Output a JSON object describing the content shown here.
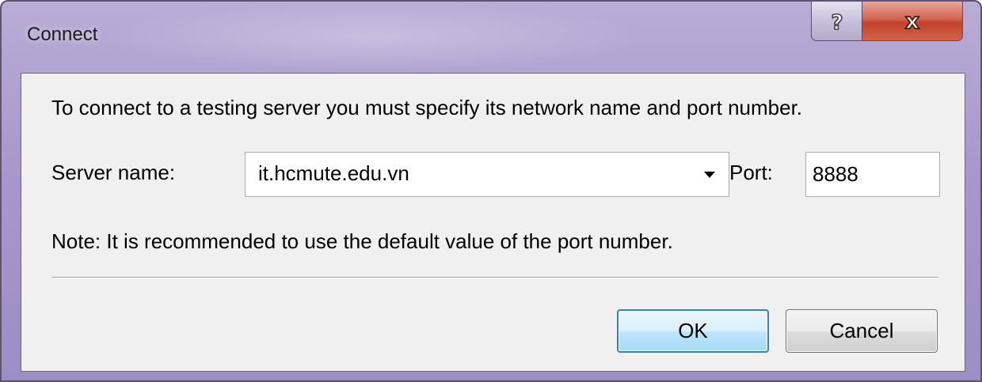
{
  "window": {
    "title": "Connect",
    "help_button_label": "?",
    "close_button_label": "x"
  },
  "dialog": {
    "instruction": "To connect to a testing server you must specify its network name and port number.",
    "server_name_label": "Server name:",
    "server_name_value": "it.hcmute.edu.vn",
    "port_label": "Port:",
    "port_value": "8888",
    "note": "Note: It is recommended to use the default value of the port number."
  },
  "buttons": {
    "ok_label": "OK",
    "cancel_label": "Cancel"
  },
  "icons": {
    "help": "help-icon",
    "close": "close-icon",
    "dropdown": "chevron-down-icon"
  },
  "colors": {
    "titlebar": "#a797cb",
    "close_button": "#c14129",
    "ok_border": "#3c7fb1",
    "client_background": "#f0f0f0"
  }
}
